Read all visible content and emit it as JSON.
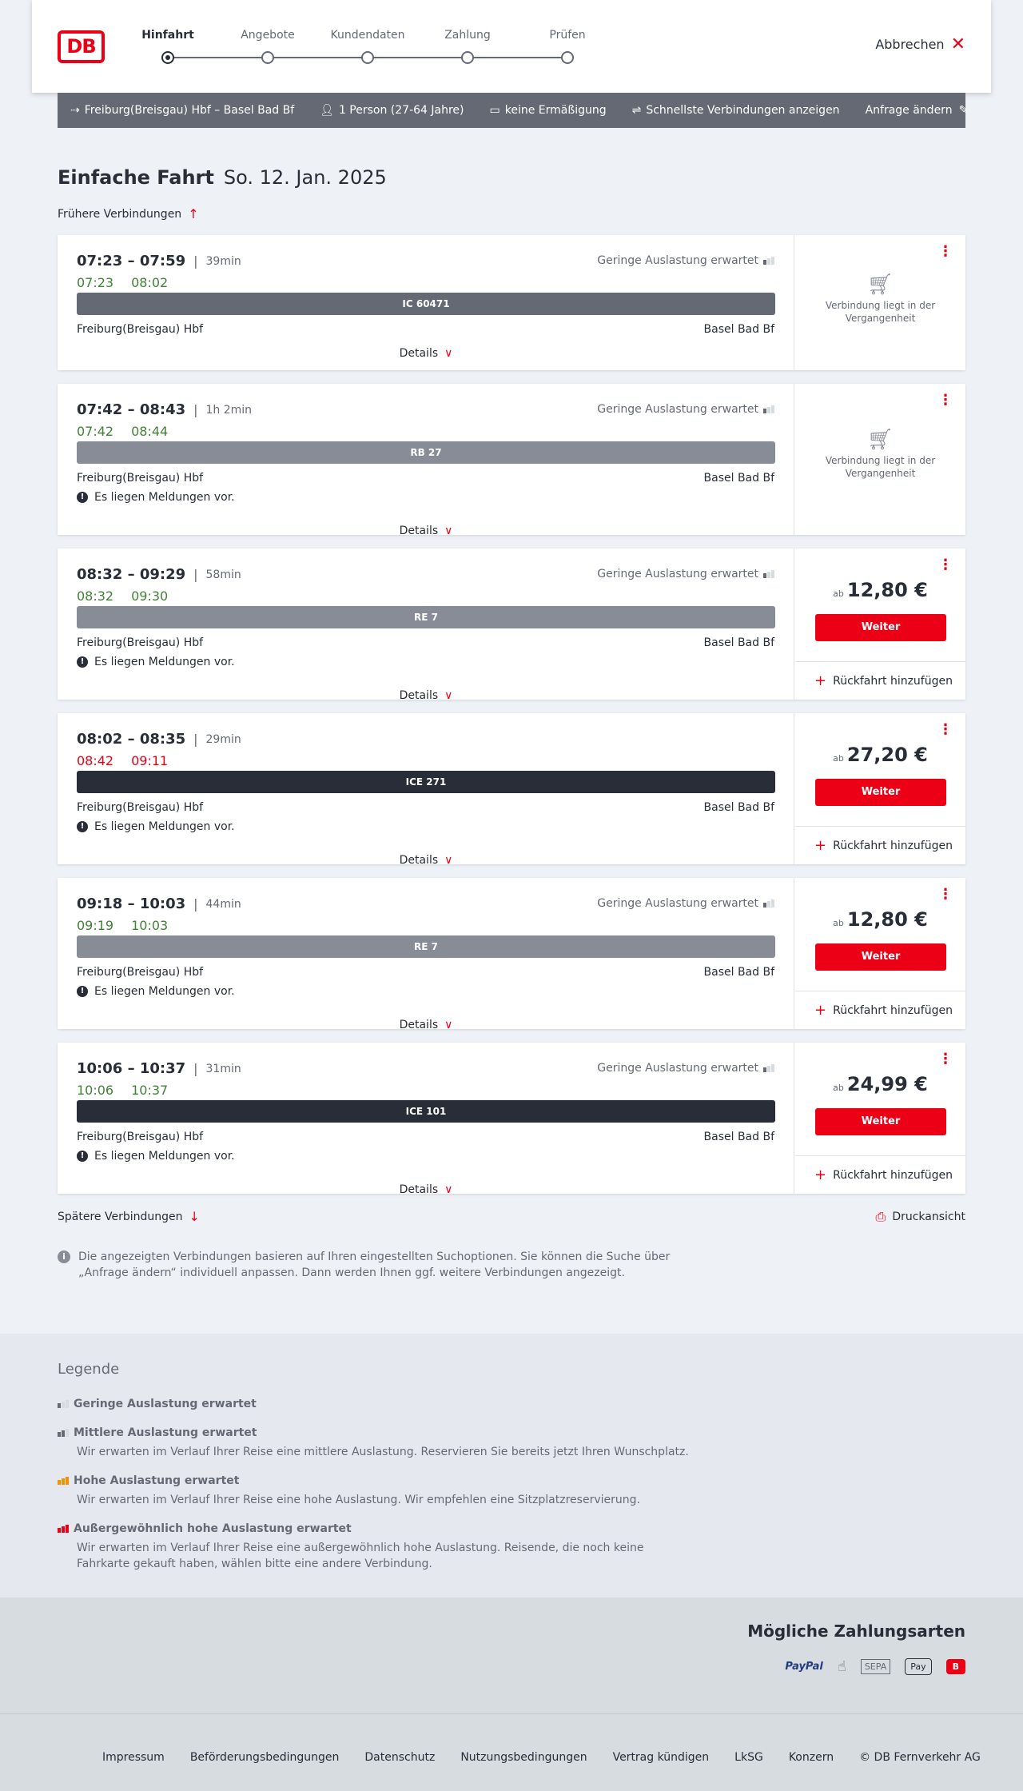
{
  "header": {
    "logo": "DB",
    "steps": [
      "Hinfahrt",
      "Angebote",
      "Kundendaten",
      "Zahlung",
      "Prüfen"
    ],
    "active_step": "Hinfahrt",
    "cancel_label": "Abbrechen"
  },
  "search": {
    "route": "Freiburg(Breisgau) Hbf – Basel Bad Bf",
    "travelers": "1 Person (27-64 Jahre)",
    "discount": "keine Ermäßigung",
    "fastest": "Schnellste Verbindungen anzeigen",
    "change": "Anfrage ändern"
  },
  "page": {
    "title": "Einfache Fahrt",
    "date": "So. 12. Jan. 2025",
    "earlier": "Frühere Verbindungen",
    "later": "Spätere Verbindungen",
    "print": "Druckansicht",
    "info": "Die angezeigten Verbindungen basieren auf Ihren eingestellten Suchoptionen. Sie können die Suche über „Anfrage ändern“ individuell anpassen. Dann werden Ihnen ggf. weitere Verbindungen angezeigt."
  },
  "labels": {
    "details": "Details",
    "weiter": "Weiter",
    "return": "Rückfahrt hinzufügen",
    "ab": "ab",
    "past": "Verbindung liegt in der Vergangenheit",
    "message": "Es liegen Meldungen vor."
  },
  "connections": [
    {
      "planned": "07:23 – 07:59",
      "duration": "39min",
      "rt_dep": "07:23",
      "rt_arr": "08:02",
      "rt_state": "ok",
      "load": "Geringe Auslastung erwartet",
      "train": "IC 60471",
      "train_type": "ic",
      "from": "Freiburg(Breisgau) Hbf",
      "to": "Basel Bad Bf",
      "message": false,
      "past": true,
      "price": ""
    },
    {
      "planned": "07:42 – 08:43",
      "duration": "1h 2min",
      "rt_dep": "07:42",
      "rt_arr": "08:44",
      "rt_state": "ok",
      "load": "Geringe Auslastung erwartet",
      "train": "RB 27",
      "train_type": "regio",
      "from": "Freiburg(Breisgau) Hbf",
      "to": "Basel Bad Bf",
      "message": true,
      "past": true,
      "price": ""
    },
    {
      "planned": "08:32 – 09:29",
      "duration": "58min",
      "rt_dep": "08:32",
      "rt_arr": "09:30",
      "rt_state": "ok",
      "load": "Geringe Auslastung erwartet",
      "train": "RE 7",
      "train_type": "regio",
      "from": "Freiburg(Breisgau) Hbf",
      "to": "Basel Bad Bf",
      "message": true,
      "past": false,
      "price": "12,80 €"
    },
    {
      "planned": "08:02 – 08:35",
      "duration": "29min",
      "rt_dep": "08:42",
      "rt_arr": "09:11",
      "rt_state": "late",
      "load": "",
      "train": "ICE 271",
      "train_type": "ice",
      "from": "Freiburg(Breisgau) Hbf",
      "to": "Basel Bad Bf",
      "message": true,
      "past": false,
      "price": "27,20 €"
    },
    {
      "planned": "09:18 – 10:03",
      "duration": "44min",
      "rt_dep": "09:19",
      "rt_arr": "10:03",
      "rt_state": "ok",
      "load": "Geringe Auslastung erwartet",
      "train": "RE 7",
      "train_type": "regio",
      "from": "Freiburg(Breisgau) Hbf",
      "to": "Basel Bad Bf",
      "message": true,
      "past": false,
      "price": "12,80 €"
    },
    {
      "planned": "10:06 – 10:37",
      "duration": "31min",
      "rt_dep": "10:06",
      "rt_arr": "10:37",
      "rt_state": "ok",
      "load": "Geringe Auslastung erwartet",
      "train": "ICE 101",
      "train_type": "ice",
      "from": "Freiburg(Breisgau) Hbf",
      "to": "Basel Bad Bf",
      "message": true,
      "past": false,
      "price": "24,99 €"
    }
  ],
  "legend": {
    "title": "Legende",
    "items": [
      {
        "title": "Geringe Auslastung erwartet",
        "desc": "",
        "color": "#646973"
      },
      {
        "title": "Mittlere Auslastung erwartet",
        "desc": "Wir erwarten im Verlauf Ihrer Reise eine mittlere Auslastung. Reservieren Sie bereits jetzt Ihren Wunschplatz.",
        "color": "#646973"
      },
      {
        "title": "Hohe Auslastung erwartet",
        "desc": "Wir erwarten im Verlauf Ihrer Reise eine hohe Auslastung. Wir empfehlen eine Sitzplatzreservierung.",
        "color": "#f39200"
      },
      {
        "title": "Außergewöhnlich hohe Auslastung erwartet",
        "desc": "Wir erwarten im Verlauf Ihrer Reise eine außergewöhnlich hohe Auslastung. Reisende, die noch keine Fahrkarte gekauft haben, wählen bitte eine andere Verbindung.",
        "color": "#ec0016"
      }
    ]
  },
  "payments": {
    "title": "Mögliche Zahlungsarten",
    "paypal": "PayPal",
    "sepa": "SEPA",
    "apple_pay": "Pay"
  },
  "footer": {
    "links": [
      "Impressum",
      "Beförderungsbedingungen",
      "Datenschutz",
      "Nutzungsbedingungen",
      "Vertrag kündigen",
      "LkSG",
      "Konzern",
      "© DB Fernverkehr AG"
    ]
  }
}
